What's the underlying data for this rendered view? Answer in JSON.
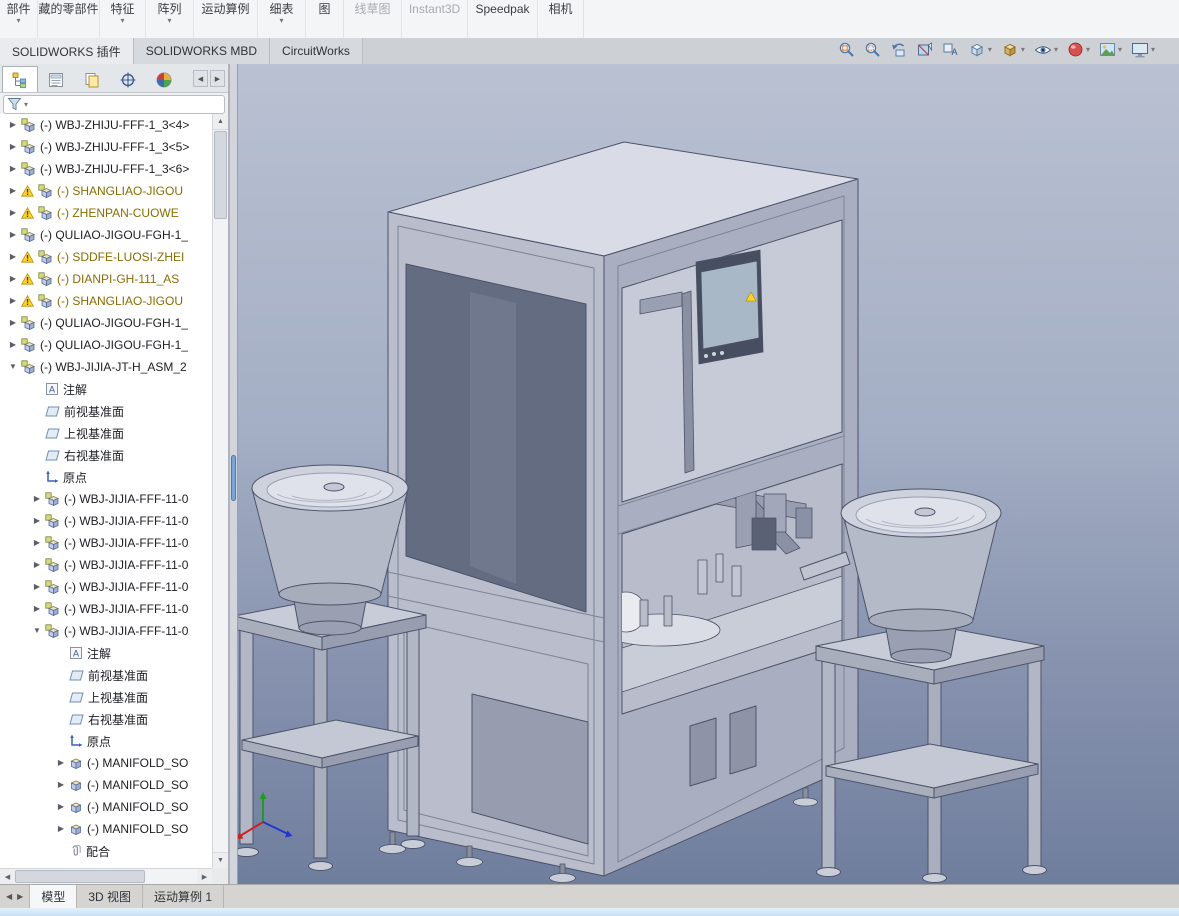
{
  "ribbon": {
    "groups": [
      {
        "label": "部件",
        "caret": true,
        "disabled": false
      },
      {
        "label": "藏的零部件",
        "caret": false,
        "disabled": false
      },
      {
        "label": "特征",
        "caret": true,
        "disabled": false
      },
      {
        "label": "阵列",
        "caret": true,
        "disabled": false
      },
      {
        "label": "运动算例",
        "caret": false,
        "disabled": false
      },
      {
        "label": "细表",
        "caret": true,
        "disabled": false
      },
      {
        "label": "图",
        "caret": false,
        "disabled": false
      },
      {
        "label": "线草图",
        "caret": false,
        "disabled": true
      },
      {
        "label": "Instant3D",
        "caret": false,
        "disabled": true
      },
      {
        "label": "Speedpak",
        "caret": false,
        "disabled": false
      },
      {
        "label": "相机",
        "caret": false,
        "disabled": false
      }
    ],
    "tabs": [
      {
        "label": "SOLIDWORKS 插件",
        "active": true
      },
      {
        "label": "SOLIDWORKS MBD",
        "active": false
      },
      {
        "label": "CircuitWorks",
        "active": false
      }
    ]
  },
  "headsup": {
    "items": [
      {
        "name": "zoom-to-fit",
        "icon": "hu-zoomfit",
        "caret": false
      },
      {
        "name": "zoom-to-area",
        "icon": "hu-zoomarea",
        "caret": false
      },
      {
        "name": "previous-view",
        "icon": "hu-prevview",
        "caret": false
      },
      {
        "name": "section-view",
        "icon": "hu-section",
        "caret": false
      },
      {
        "name": "dynamic-annotation-views",
        "icon": "hu-annot",
        "caret": false
      },
      {
        "name": "view-orientation",
        "icon": "hu-orient",
        "caret": true
      },
      {
        "name": "display-style",
        "icon": "hu-style",
        "caret": true
      },
      {
        "name": "hide-show-items",
        "icon": "hu-eye",
        "caret": true
      },
      {
        "name": "edit-appearance",
        "icon": "hu-appearance",
        "caret": true
      },
      {
        "name": "apply-scene",
        "icon": "hu-scene",
        "caret": true
      },
      {
        "name": "view-settings",
        "icon": "hu-monitor",
        "caret": true
      }
    ]
  },
  "left_panel": {
    "tabs": [
      {
        "name": "featuremanager-tree",
        "icon": "fm-tree",
        "active": true
      },
      {
        "name": "propertymanager",
        "icon": "fm-props",
        "active": false
      },
      {
        "name": "configurationmanager",
        "icon": "fm-config",
        "active": false
      },
      {
        "name": "dimxpertmanager",
        "icon": "fm-dimx",
        "active": false
      },
      {
        "name": "displaymanager",
        "icon": "fm-display",
        "active": false
      }
    ],
    "filter": {
      "value": "",
      "placeholder": ""
    },
    "tree": {
      "items": [
        {
          "indent": 0,
          "arrow": "collapsed",
          "icon": "component",
          "warning": false,
          "label": "(-) WBJ-ZHIJU-FFF-1_3<4>"
        },
        {
          "indent": 0,
          "arrow": "collapsed",
          "icon": "component",
          "warning": false,
          "label": "(-) WBJ-ZHIJU-FFF-1_3<5>"
        },
        {
          "indent": 0,
          "arrow": "collapsed",
          "icon": "component",
          "warning": false,
          "label": "(-) WBJ-ZHIJU-FFF-1_3<6>"
        },
        {
          "indent": 0,
          "arrow": "collapsed",
          "icon": "component",
          "warning": true,
          "label": "(-) SHANGLIAO-JIGOU"
        },
        {
          "indent": 0,
          "arrow": "collapsed",
          "icon": "component",
          "warning": true,
          "label": "(-) ZHENPAN-CUOWE"
        },
        {
          "indent": 0,
          "arrow": "collapsed",
          "icon": "component",
          "warning": false,
          "label": "(-) QULIAO-JIGOU-FGH-1_"
        },
        {
          "indent": 0,
          "arrow": "collapsed",
          "icon": "component",
          "warning": true,
          "label": "(-) SDDFE-LUOSI-ZHEI"
        },
        {
          "indent": 0,
          "arrow": "collapsed",
          "icon": "component",
          "warning": true,
          "label": "(-) DIANPI-GH-111_AS"
        },
        {
          "indent": 0,
          "arrow": "collapsed",
          "icon": "component",
          "warning": true,
          "label": "(-) SHANGLIAO-JIGOU"
        },
        {
          "indent": 0,
          "arrow": "collapsed",
          "icon": "component",
          "warning": false,
          "label": "(-) QULIAO-JIGOU-FGH-1_"
        },
        {
          "indent": 0,
          "arrow": "collapsed",
          "icon": "component",
          "warning": false,
          "label": "(-) QULIAO-JIGOU-FGH-1_"
        },
        {
          "indent": 0,
          "arrow": "expanded",
          "icon": "component",
          "warning": false,
          "label": "(-) WBJ-JIJIA-JT-H_ASM_2"
        },
        {
          "indent": 1,
          "arrow": null,
          "icon": "annotations",
          "warning": false,
          "label": "注解"
        },
        {
          "indent": 1,
          "arrow": null,
          "icon": "plane",
          "warning": false,
          "label": "前视基准面"
        },
        {
          "indent": 1,
          "arrow": null,
          "icon": "plane",
          "warning": false,
          "label": "上视基准面"
        },
        {
          "indent": 1,
          "arrow": null,
          "icon": "plane",
          "warning": false,
          "label": "右视基准面"
        },
        {
          "indent": 1,
          "arrow": null,
          "icon": "origin",
          "warning": false,
          "label": "原点"
        },
        {
          "indent": 1,
          "arrow": "collapsed",
          "icon": "component",
          "warning": false,
          "label": "(-) WBJ-JIJIA-FFF-11-0"
        },
        {
          "indent": 1,
          "arrow": "collapsed",
          "icon": "component",
          "warning": false,
          "label": "(-) WBJ-JIJIA-FFF-11-0"
        },
        {
          "indent": 1,
          "arrow": "collapsed",
          "icon": "component",
          "warning": false,
          "label": "(-) WBJ-JIJIA-FFF-11-0"
        },
        {
          "indent": 1,
          "arrow": "collapsed",
          "icon": "component",
          "warning": false,
          "label": "(-) WBJ-JIJIA-FFF-11-0"
        },
        {
          "indent": 1,
          "arrow": "collapsed",
          "icon": "component",
          "warning": false,
          "label": "(-) WBJ-JIJIA-FFF-11-0"
        },
        {
          "indent": 1,
          "arrow": "collapsed",
          "icon": "component",
          "warning": false,
          "label": "(-) WBJ-JIJIA-FFF-11-0"
        },
        {
          "indent": 1,
          "arrow": "expanded",
          "icon": "component",
          "warning": false,
          "label": "(-) WBJ-JIJIA-FFF-11-0"
        },
        {
          "indent": 2,
          "arrow": null,
          "icon": "annotations",
          "warning": false,
          "label": "注解"
        },
        {
          "indent": 2,
          "arrow": null,
          "icon": "plane",
          "warning": false,
          "label": "前视基准面"
        },
        {
          "indent": 2,
          "arrow": null,
          "icon": "plane",
          "warning": false,
          "label": "上视基准面"
        },
        {
          "indent": 2,
          "arrow": null,
          "icon": "plane",
          "warning": false,
          "label": "右视基准面"
        },
        {
          "indent": 2,
          "arrow": null,
          "icon": "origin",
          "warning": false,
          "label": "原点"
        },
        {
          "indent": 2,
          "arrow": "collapsed",
          "icon": "part",
          "warning": false,
          "label": "(-) MANIFOLD_SO"
        },
        {
          "indent": 2,
          "arrow": "collapsed",
          "icon": "part",
          "warning": false,
          "label": "(-) MANIFOLD_SO"
        },
        {
          "indent": 2,
          "arrow": "collapsed",
          "icon": "part",
          "warning": false,
          "label": "(-) MANIFOLD_SO"
        },
        {
          "indent": 2,
          "arrow": "collapsed",
          "icon": "part",
          "warning": false,
          "label": "(-) MANIFOLD_SO"
        },
        {
          "indent": 2,
          "arrow": null,
          "icon": "mates",
          "warning": false,
          "label": "配合"
        }
      ]
    }
  },
  "bottom_bar": {
    "tabs": [
      {
        "label": "模型",
        "active": true
      },
      {
        "label": "3D 视图",
        "active": false
      },
      {
        "label": "运动算例 1",
        "active": false
      }
    ]
  },
  "colors": {
    "viewport_gradient_top": "#b9c1d2",
    "viewport_gradient_bottom": "#707e9e",
    "model_gray": "#b6bac8",
    "warning_text": "#8a6d00",
    "splitter_grip_blue": "#72a7dc",
    "status_bar_blue": "#d7eaf9"
  }
}
